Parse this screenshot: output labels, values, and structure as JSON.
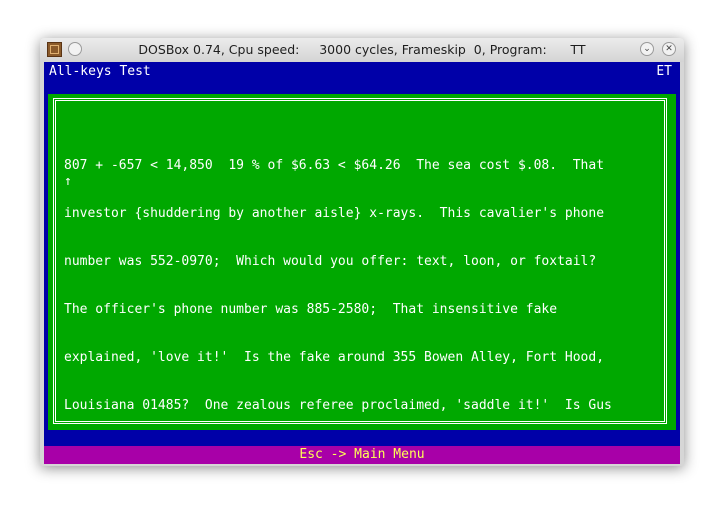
{
  "window": {
    "title": "DOSBox 0.74, Cpu speed:     3000 cycles, Frameskip  0, Program:      TT",
    "minimize_glyph": "⌄",
    "close_glyph": "✕"
  },
  "screen": {
    "header_left": "All-keys Test",
    "header_right": "ET",
    "lines": [
      "807 + -657 < 14,850  19 % of $6.63 < $64.26  The sea cost $.08.  That",
      "↑",
      "investor {shuddering by another aisle} x-rays.  This cavalier's phone",
      "number was 552-0970;  Which would you offer: text, loon, or foxtail?",
      "The officer's phone number was 885-2580;  That insensitive fake",
      "explained, 'love it!'  Is the fake around 355 Bowen Alley, Fort Hood,",
      "Louisiana 01485?  One zealous referee proclaimed, 'saddle it!'  Is Gus"
    ],
    "status": "Esc -> Main Menu"
  },
  "colors": {
    "screen_bg": "#0000a8",
    "text_area": "#00a800",
    "status_bg": "#a800a8",
    "status_text": "#ffff55"
  },
  "icons": {
    "app": "dosbox-icon",
    "menu": "window-menu-icon",
    "minimize": "chevron-down-icon",
    "close": "close-icon"
  }
}
